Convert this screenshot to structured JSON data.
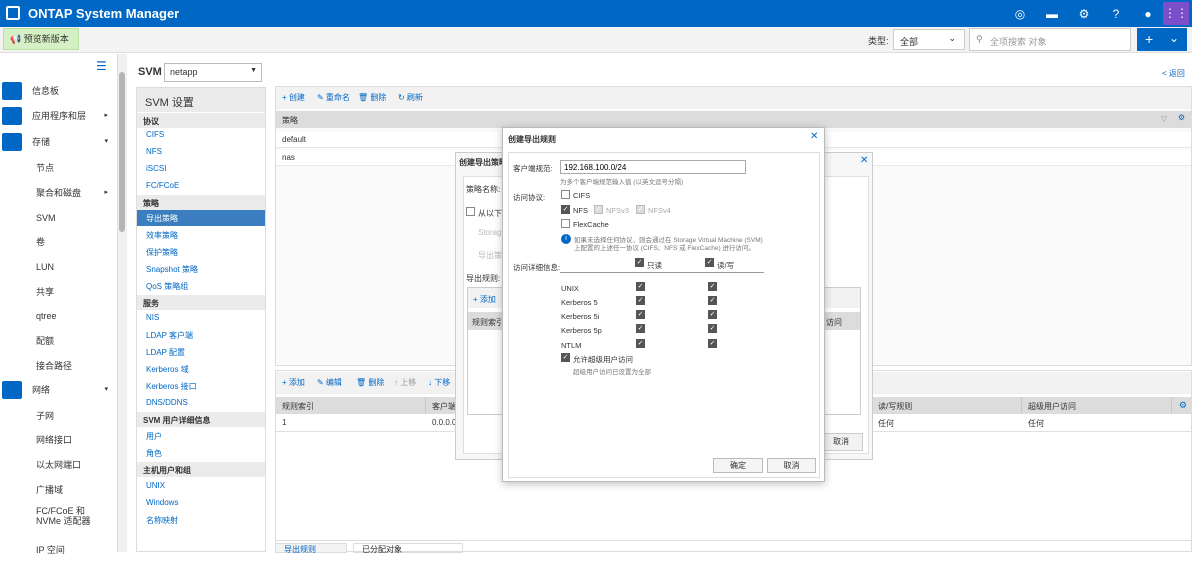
{
  "header": {
    "title": "ONTAP System Manager",
    "icons": [
      "compass-icon",
      "chat-icon",
      "gear-icon",
      "help-icon",
      "user-icon",
      "apps-grid-icon"
    ],
    "accent": "#0067c5"
  },
  "toolbar": {
    "preview_label": "预览新版本",
    "type_label": "类型:",
    "type_value": "全部",
    "search_placeholder": "全项搜索 对象",
    "add_label": "+"
  },
  "nav": {
    "items": [
      {
        "label": "信息板",
        "icon": "dashboard-icon"
      },
      {
        "label": "应用程序和层",
        "icon": "app-icon",
        "arrow": "▸"
      },
      {
        "label": "存储",
        "icon": "storage-icon",
        "arrow": "▾"
      },
      {
        "label": "节点"
      },
      {
        "label": "聚合和磁盘",
        "arrow": "▸"
      },
      {
        "label": "SVM"
      },
      {
        "label": "卷"
      },
      {
        "label": "LUN"
      },
      {
        "label": "共享"
      },
      {
        "label": "qtree"
      },
      {
        "label": "配额"
      },
      {
        "label": "接合路径"
      },
      {
        "label": "网络",
        "icon": "network-icon",
        "arrow": "▾"
      },
      {
        "label": "子网"
      },
      {
        "label": "网络接口"
      },
      {
        "label": "以太网端口"
      },
      {
        "label": "广播域"
      },
      {
        "label": "FC/FCoE 和 NVMe 适配器"
      },
      {
        "label": "IP 空间"
      }
    ]
  },
  "svm": {
    "label": "SVM",
    "value": "netapp"
  },
  "settings": {
    "title": "SVM 设置",
    "groups": [
      {
        "head": "协议",
        "items": [
          "CIFS",
          "NFS",
          "iSCSI",
          "FC/FCoE"
        ]
      },
      {
        "head": "策略",
        "items": [
          "导出策略",
          "效率策略",
          "保护策略",
          "Snapshot 策略",
          "QoS 策略组"
        ]
      },
      {
        "head": "服务",
        "items": [
          "NIS",
          "LDAP 客户端",
          "LDAP 配置",
          "Kerberos 域",
          "Kerberos 接口",
          "DNS/DDNS"
        ]
      },
      {
        "head": "SVM 用户详细信息",
        "items": [
          "用户",
          "角色"
        ]
      },
      {
        "head": "主机用户和组",
        "items": [
          "UNIX",
          "Windows",
          "名称映射"
        ]
      }
    ]
  },
  "back_label": "< 返回",
  "policies": {
    "toolbar": [
      "+ 创建",
      "✎ 重命名",
      "🗑 删除",
      "↻ 刷新"
    ],
    "header": "策略",
    "rows": [
      "default",
      "nas"
    ]
  },
  "rules": {
    "toolbar": [
      "+ 添加",
      "✎ 编辑",
      "🗑 删除",
      "↑ 上移",
      "↓ 下移"
    ],
    "headers": [
      "规则索引",
      "客户端",
      "",
      "读/写规则",
      "超级用户访问"
    ],
    "row": {
      "index": "1",
      "client": "0.0.0.0",
      "rw": "任何",
      "superuser": "任何"
    }
  },
  "bottom_tabs": [
    "导出规则",
    "已分配对象"
  ],
  "overlay": {
    "title": "创建导出策略",
    "policy_name": "策略名称:",
    "copy_from": "从以下位",
    "storage": "Storage",
    "export": "导出策略",
    "rules_label": "导出规则:",
    "add": "+ 添加",
    "col_index": "规则索引",
    "col_access": "访问",
    "cancel": "取消"
  },
  "dialog": {
    "title": "创建导出规则",
    "client_label": "客户端规范:",
    "client_value": "192.168.100.0/24",
    "client_hint": "为多个客户端规范输入值 (以英文逗号分隔)",
    "protocols_label": "访问协议:",
    "protocols": [
      {
        "label": "CIFS",
        "checked": false
      },
      {
        "label": "NFS",
        "checked": true
      },
      {
        "label": "NFSv3",
        "checked": true,
        "disabled": true
      },
      {
        "label": "NFSv4",
        "checked": true,
        "disabled": true
      },
      {
        "label": "FlexCache",
        "checked": false
      }
    ],
    "info_text_1": "如果未选择任何协议，则会通过在 Storage Virtual Machine (SVM)",
    "info_text_2": "上配置的上述任一协议 (CIFS、NFS 或 FlexCache) 进行访问。",
    "access_label": "访问详细信息:",
    "ro_label": "只读",
    "rw_label": "读/写",
    "access_rows": [
      "UNIX",
      "Kerberos 5",
      "Kerberos 5i",
      "Kerberos 5p",
      "NTLM"
    ],
    "superuser_label": "允许超级用户访问",
    "superuser_hint": "超级用户访问已设置为全部",
    "ok": "确定",
    "cancel": "取消"
  }
}
